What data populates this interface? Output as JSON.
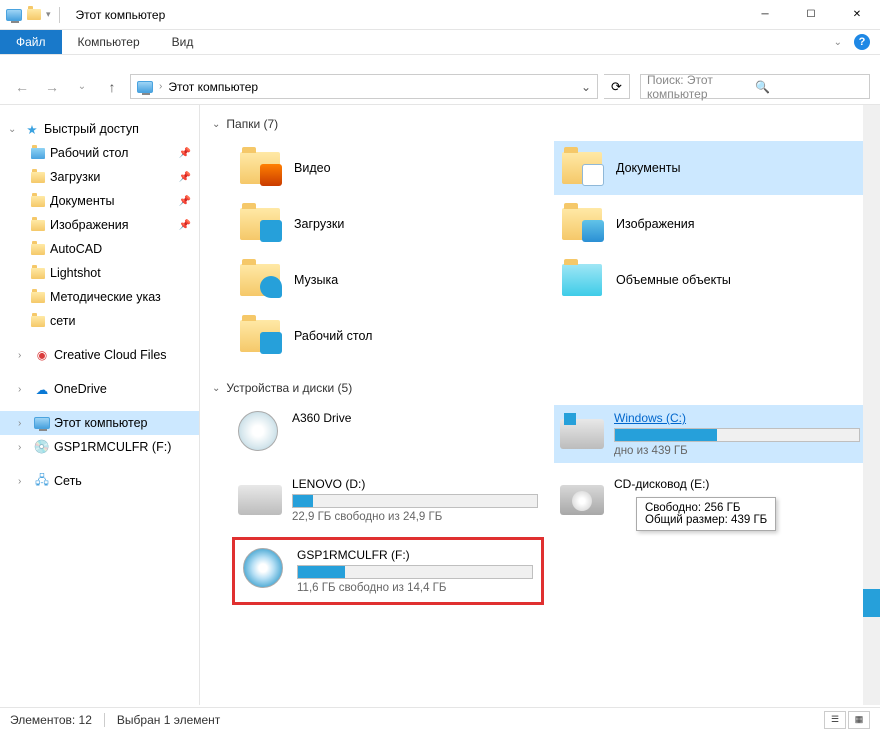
{
  "titlebar": {
    "title": "Этот компьютер"
  },
  "ribbon": {
    "file": "Файл",
    "home": "Компьютер",
    "view": "Вид"
  },
  "address": {
    "path": "Этот компьютер"
  },
  "search": {
    "placeholder": "Поиск: Этот компьютер"
  },
  "sidebar": {
    "quick_access": "Быстрый доступ",
    "items": [
      {
        "label": "Рабочий стол",
        "pinned": true
      },
      {
        "label": "Загрузки",
        "pinned": true
      },
      {
        "label": "Документы",
        "pinned": true
      },
      {
        "label": "Изображения",
        "pinned": true
      },
      {
        "label": "AutoCAD",
        "pinned": false
      },
      {
        "label": "Lightshot",
        "pinned": false
      },
      {
        "label": "Методические указ",
        "pinned": false
      },
      {
        "label": "сети",
        "pinned": false
      }
    ],
    "creative_cloud": "Creative Cloud Files",
    "onedrive": "OneDrive",
    "this_pc": "Этот компьютер",
    "drive_f": "GSP1RMCULFR (F:)",
    "network": "Сеть"
  },
  "groups": {
    "folders": "Папки (7)",
    "devices": "Устройства и диски (5)"
  },
  "folders": [
    {
      "label": "Видео"
    },
    {
      "label": "Документы"
    },
    {
      "label": "Загрузки"
    },
    {
      "label": "Изображения"
    },
    {
      "label": "Музыка"
    },
    {
      "label": "Объемные объекты"
    },
    {
      "label": "Рабочий стол"
    }
  ],
  "drives": [
    {
      "name": "A360 Drive",
      "type": "cloud"
    },
    {
      "name": "Windows (C:)",
      "free": "дно из 439 ГБ",
      "fill": 42,
      "link": true
    },
    {
      "name": "LENOVO (D:)",
      "free": "22,9 ГБ свободно из 24,9 ГБ",
      "fill": 8
    },
    {
      "name": "CD-дисковод (E:)",
      "type": "cd"
    },
    {
      "name": "GSP1RMCULFR (F:)",
      "free": "11,6 ГБ свободно из 14,4 ГБ",
      "fill": 20,
      "highlighted": true
    }
  ],
  "tooltip": {
    "line1": "Свободно: 256 ГБ",
    "line2": "Общий размер: 439 ГБ"
  },
  "statusbar": {
    "count": "Элементов: 12",
    "selected": "Выбран 1 элемент"
  }
}
